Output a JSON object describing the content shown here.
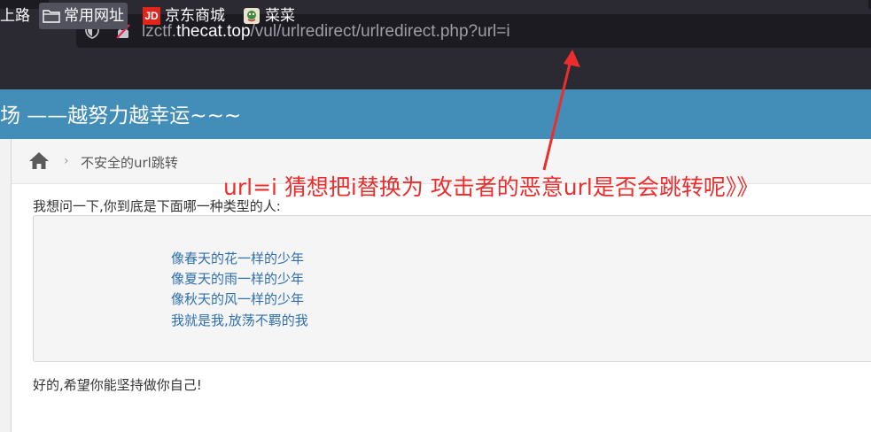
{
  "browser": {
    "url_prefix": "lzctf.",
    "url_host": "thecat.top",
    "url_path": "/vul/urlredirect/urlredirect.php?url=i",
    "bookmarks": [
      {
        "label": "上路",
        "icon": "none"
      },
      {
        "label": "常用网址",
        "icon": "folder-icon"
      },
      {
        "label": "京东商城",
        "icon": "jd-icon",
        "icon_text": "JD"
      },
      {
        "label": "菜菜",
        "icon": "cai-icon"
      }
    ]
  },
  "banner": {
    "title": "靶场 ——越努力越幸运~~~",
    "color": "#438eb9"
  },
  "breadcrumb": {
    "separator": "›",
    "current": "不安全的url跳转"
  },
  "content": {
    "question": "我想问一下,你到底是下面哪一种类型的人:",
    "choices": [
      "像春天的花一样的少年",
      "像夏天的雨一样的少年",
      "像秋天的风一样的少年",
      "我就是我,放荡不羁的我"
    ],
    "reply": "好的,希望你能坚持做你自己!"
  },
  "annotation": {
    "text": "url=i 猜想把i替换为 攻击者的恶意url是否会跳转呢》》",
    "color": "#ec2d2d"
  }
}
